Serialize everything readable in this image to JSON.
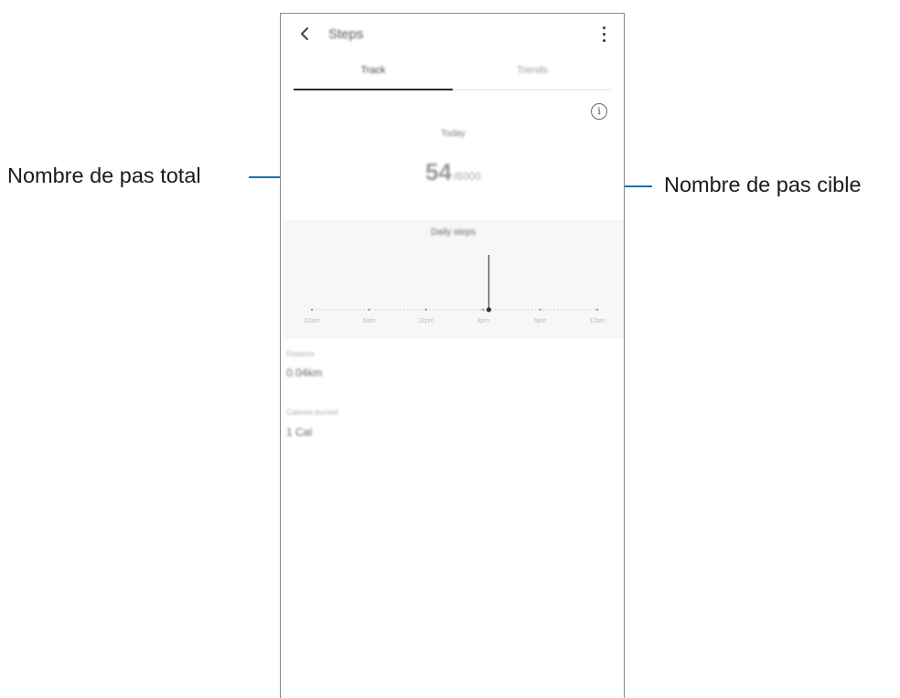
{
  "callouts": {
    "left": "Nombre de pas total",
    "right": "Nombre de pas cible"
  },
  "app_bar": {
    "back_icon": "chevron-left-icon",
    "title": "Steps",
    "more_icon": "more-vertical-icon"
  },
  "tabs": [
    {
      "label": "Track",
      "active": true
    },
    {
      "label": "Trends",
      "active": false
    }
  ],
  "info_icon": "info-icon",
  "summary": {
    "date": "Today",
    "steps_total": "54",
    "steps_target": "/6000"
  },
  "chart": {
    "title": "Daily steps",
    "ticks": [
      "12am",
      "6am",
      "12pm",
      "3pm",
      "6pm",
      "12am"
    ],
    "current_position_fraction": 0.62,
    "current_bar_fraction": 0.75
  },
  "stats": [
    {
      "label": "Distance",
      "value": "0.04km"
    },
    {
      "label": "Calories burned",
      "value": "1 Cal"
    }
  ],
  "colors": {
    "callout_line": "#1c6fa8",
    "chart_band": "#f7f7f7"
  }
}
